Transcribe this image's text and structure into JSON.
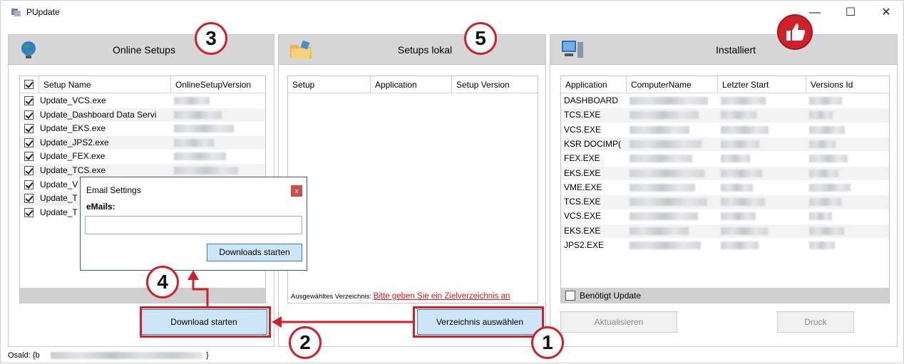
{
  "window": {
    "title": "PUpdate",
    "minimize": "—",
    "maximize": "☐",
    "close": "✕"
  },
  "online_panel": {
    "title": "Online Setups",
    "columns": [
      "Setup Name",
      "OnlineSetupVersion"
    ],
    "rows": [
      {
        "name": "Update_VCS.exe",
        "checked": true
      },
      {
        "name": "Update_Dashboard Data Servi",
        "checked": true
      },
      {
        "name": "Update_EKS.exe",
        "checked": true
      },
      {
        "name": "Update_JPS2.exe",
        "checked": true
      },
      {
        "name": "Update_FEX.exe",
        "checked": true
      },
      {
        "name": "Update_TCS.exe",
        "checked": true
      },
      {
        "name": "Update_V",
        "checked": true
      },
      {
        "name": "Update_T",
        "checked": true
      },
      {
        "name": "Update_T",
        "checked": true
      }
    ],
    "download_button": "Download starten"
  },
  "local_panel": {
    "title": "Setups lokal",
    "columns": [
      "Setup",
      "Application",
      "Setup Version"
    ],
    "dir_label": "Ausgewähltes Verzeichnis:",
    "dir_value": "Bitte geben Sie ein Zielverzeichnis an",
    "select_dir_button": "Verzeichnis auswählen"
  },
  "installed_panel": {
    "title": "Installiert",
    "columns": [
      "Application",
      "ComputerName",
      "Letzter Start",
      "Versions Id"
    ],
    "rows": [
      "DASHBOARD",
      "TCS.EXE",
      "VCS.EXE",
      "KSR DOCIMP(",
      "FEX.EXE",
      "EKS.EXE",
      "VME.EXE",
      "TCS.EXE",
      "VCS.EXE",
      "EKS.EXE",
      "JPS2.EXE"
    ],
    "needs_update_label": "Benötigt Update",
    "refresh_button": "Aktualisieren",
    "print_button": "Druck"
  },
  "email_dialog": {
    "title": "Email Settings",
    "close": "x",
    "label": "eMails:",
    "input_value": "",
    "button": "Downloads starten"
  },
  "annotations": [
    "3",
    "5",
    "4",
    "2",
    "1"
  ],
  "status_bar": {
    "text": "Osald: {b",
    "end": "}"
  },
  "colors": {
    "accent_red": "#d0212a",
    "button_blue": "#cde6f7",
    "panel_header": "#d6d6d6"
  }
}
